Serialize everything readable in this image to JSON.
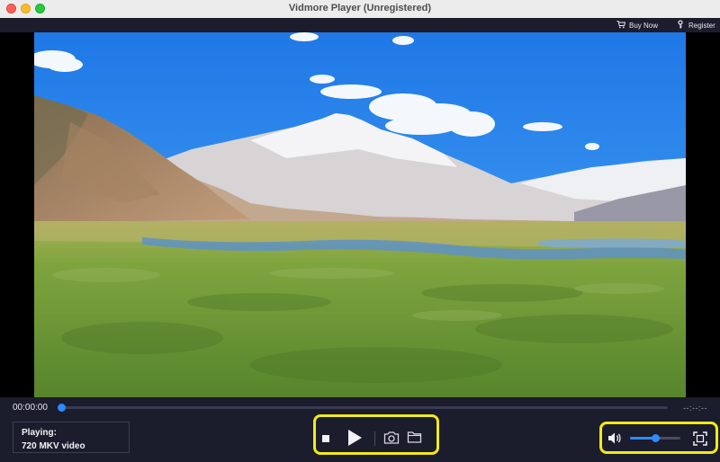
{
  "window": {
    "title": "Vidmore Player (Unregistered)"
  },
  "toolbar": {
    "buy_now": "Buy Now",
    "register": "Register"
  },
  "playback": {
    "current_time": "00:00:00",
    "end_time": "--:--:--",
    "progress": 0.0
  },
  "now_playing": {
    "label": "Playing:",
    "file": "720 MKV video"
  },
  "volume": {
    "level": 0.5
  },
  "icons": [
    "cart-icon",
    "key-icon",
    "stop-icon",
    "play-icon",
    "camera-icon",
    "folder-icon",
    "speaker-icon",
    "fullscreen-icon"
  ],
  "colors": {
    "accent": "#2c8cff",
    "highlight": "#f3ea16",
    "background": "#1b1c2c"
  }
}
